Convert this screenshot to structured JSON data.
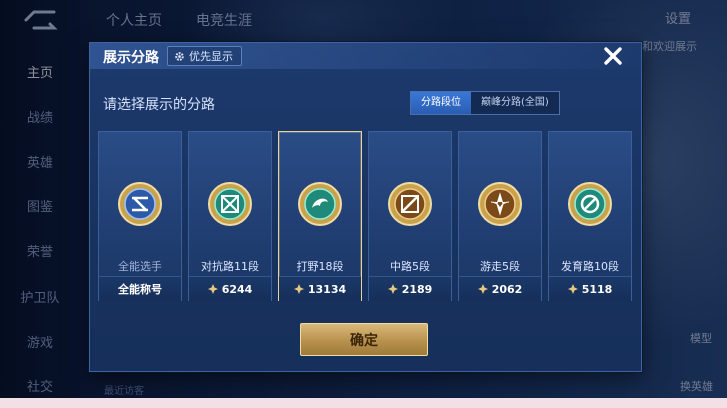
{
  "background": {
    "top_tabs": [
      "个人主页",
      "电竞生涯"
    ],
    "settings_label": "设置",
    "left_nav": [
      "主页",
      "战绩",
      "英雄",
      "图鉴",
      "荣誉",
      "护卫队",
      "游戏",
      "社交"
    ],
    "right_labels": [
      "模型",
      "换英雄"
    ],
    "bottom_hint": "最近访客",
    "right_top_text": "和欢迎展示"
  },
  "dialog": {
    "title": "展示分路",
    "priority_button": "优先显示",
    "close_icon": "close-icon",
    "prompt": "请选择展示的分路",
    "tabs": [
      {
        "label": "分路段位",
        "active": true
      },
      {
        "label": "巅峰分路(全国)",
        "active": false
      }
    ],
    "cards": [
      {
        "label": "全能选手",
        "footer": "全能称号",
        "show_star": false,
        "selected": false,
        "emblem": "all-round-emblem-icon"
      },
      {
        "label": "对抗路11段",
        "footer": "6244",
        "show_star": true,
        "selected": false,
        "emblem": "clash-lane-emblem-icon"
      },
      {
        "label": "打野18段",
        "footer": "13134",
        "show_star": true,
        "selected": true,
        "emblem": "jungle-emblem-icon"
      },
      {
        "label": "中路5段",
        "footer": "2189",
        "show_star": true,
        "selected": false,
        "emblem": "mid-lane-emblem-icon"
      },
      {
        "label": "游走5段",
        "footer": "2062",
        "show_star": true,
        "selected": false,
        "emblem": "roam-emblem-icon"
      },
      {
        "label": "发育路10段",
        "footer": "5118",
        "show_star": true,
        "selected": false,
        "emblem": "farm-lane-emblem-icon"
      }
    ],
    "confirm_button": "确定"
  },
  "colors": {
    "accent_gold": "#d9b97a",
    "tab_active": "#3a78d6",
    "dialog_bg": "#1d3a6e"
  }
}
